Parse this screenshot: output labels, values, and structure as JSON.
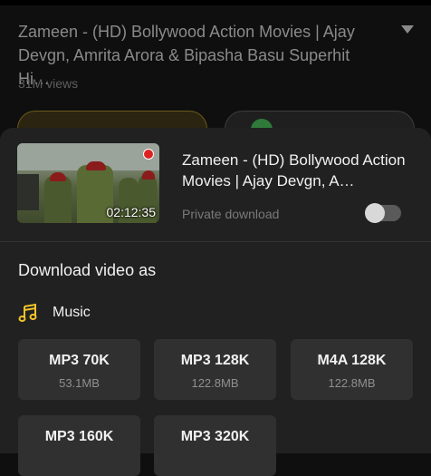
{
  "video": {
    "title": "Zameen - (HD) Bollywood Action Movies | Ajay Devgn, Amrita Arora & Bipasha Basu Superhit Hi…",
    "views": "31M views"
  },
  "sheet": {
    "title": "Zameen - (HD) Bollywood Action Movies | Ajay Devgn, A…",
    "duration": "02:12:35",
    "private_download_label": "Private download",
    "private_download_enabled": false,
    "section_title": "Download video as",
    "music_label": "Music",
    "options": [
      {
        "quality": "MP3 70K",
        "size": "53.1MB"
      },
      {
        "quality": "MP3 128K",
        "size": "122.8MB"
      },
      {
        "quality": "M4A 128K",
        "size": "122.8MB"
      },
      {
        "quality": "MP3 160K",
        "size": ""
      },
      {
        "quality": "MP3 320K",
        "size": ""
      }
    ]
  },
  "colors": {
    "accent": "#f2c32a",
    "sheet_bg": "#212121",
    "option_bg": "#303030"
  },
  "icons": [
    "chevron-down-icon",
    "music-note-icon"
  ]
}
